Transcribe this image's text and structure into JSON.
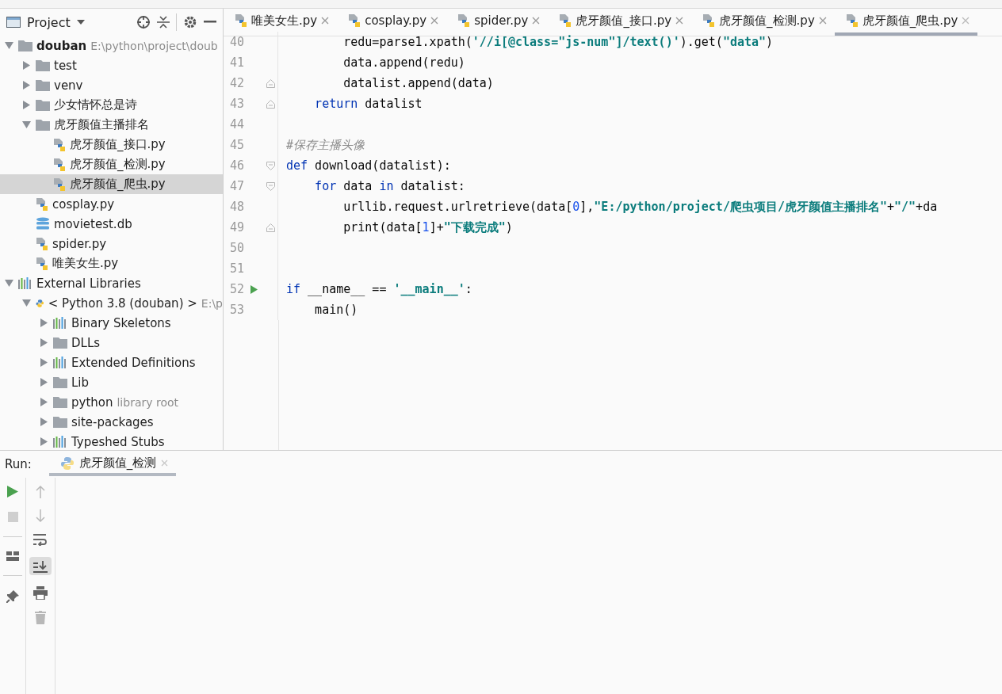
{
  "project_panel": {
    "title": "Project",
    "tree": [
      {
        "label": "douban",
        "hint": "E:\\python\\project\\doub",
        "kind": "folder",
        "bold": true,
        "expanded": true,
        "selected": false,
        "children": [
          {
            "label": "test",
            "kind": "folder",
            "expanded": false,
            "selected": false
          },
          {
            "label": "venv",
            "kind": "folder",
            "expanded": false,
            "selected": false
          },
          {
            "label": "少女情怀总是诗",
            "kind": "folder",
            "expanded": false,
            "selected": false
          },
          {
            "label": "虎牙颜值主播排名",
            "kind": "folder",
            "expanded": true,
            "selected": false,
            "children": [
              {
                "label": "虎牙颜值_接口.py",
                "kind": "python",
                "selected": false
              },
              {
                "label": "虎牙颜值_检测.py",
                "kind": "python",
                "selected": false
              },
              {
                "label": "虎牙颜值_爬虫.py",
                "kind": "python",
                "selected": true
              }
            ]
          },
          {
            "label": "cosplay.py",
            "kind": "python",
            "selected": false
          },
          {
            "label": "movietest.db",
            "kind": "database",
            "selected": false
          },
          {
            "label": "spider.py",
            "kind": "python",
            "selected": false
          },
          {
            "label": "唯美女生.py",
            "kind": "python",
            "selected": false
          }
        ]
      },
      {
        "label": "External Libraries",
        "kind": "library",
        "expanded": true,
        "selected": false,
        "children": [
          {
            "label": "< Python 3.8 (douban) >",
            "hint": "E:\\p",
            "kind": "interpreter",
            "expanded": true,
            "selected": false,
            "children": [
              {
                "label": "Binary Skeletons",
                "kind": "library",
                "expanded": false,
                "selected": false
              },
              {
                "label": "DLLs",
                "kind": "folder",
                "expanded": false,
                "selected": false
              },
              {
                "label": "Extended Definitions",
                "kind": "library",
                "expanded": false,
                "selected": false
              },
              {
                "label": "Lib",
                "kind": "folder",
                "expanded": false,
                "selected": false
              },
              {
                "label": "python",
                "hint": "library root",
                "kind": "folder",
                "expanded": false,
                "selected": false
              },
              {
                "label": "site-packages",
                "kind": "folder",
                "expanded": false,
                "selected": false
              },
              {
                "label": "Typeshed Stubs",
                "kind": "library",
                "expanded": false,
                "selected": false
              }
            ]
          }
        ]
      }
    ]
  },
  "editor_tabs": [
    {
      "label": "唯美女生.py",
      "selected": false
    },
    {
      "label": "cosplay.py",
      "selected": false
    },
    {
      "label": "spider.py",
      "selected": false
    },
    {
      "label": "虎牙颜值_接口.py",
      "selected": false
    },
    {
      "label": "虎牙颜值_检测.py",
      "selected": false
    },
    {
      "label": "虎牙颜值_爬虫.py",
      "selected": true
    }
  ],
  "code": [
    {
      "number": "40",
      "tokens": [
        {
          "kind": "plain",
          "text": "        redu=parse1.xpath("
        },
        {
          "kind": "string",
          "text": "'//i[@class=\"js-num\"]/text()'"
        },
        {
          "kind": "plain",
          "text": ").get("
        },
        {
          "kind": "string",
          "text": "\"data\""
        },
        {
          "kind": "plain",
          "text": ")"
        }
      ]
    },
    {
      "number": "41",
      "tokens": [
        {
          "kind": "plain",
          "text": "        data.append(redu)"
        }
      ]
    },
    {
      "number": "42",
      "fold_end": true,
      "tokens": [
        {
          "kind": "plain",
          "text": "        datalist.append(data)"
        }
      ]
    },
    {
      "number": "43",
      "fold_end": true,
      "tokens": [
        {
          "kind": "keyword",
          "text": "    return"
        },
        {
          "kind": "plain",
          "text": " datalist"
        }
      ]
    },
    {
      "number": "44"
    },
    {
      "number": "45",
      "tokens": [
        {
          "kind": "comment",
          "text": "#保存主播头像"
        }
      ]
    },
    {
      "number": "46",
      "fold_start": true,
      "tokens": [
        {
          "kind": "keyword",
          "text": "def"
        },
        {
          "kind": "plain",
          "text": " download(datalist):"
        }
      ]
    },
    {
      "number": "47",
      "fold_start": true,
      "tokens": [
        {
          "kind": "keyword",
          "text": "    for"
        },
        {
          "kind": "plain",
          "text": " data "
        },
        {
          "kind": "keyword",
          "text": "in"
        },
        {
          "kind": "plain",
          "text": " datalist:"
        }
      ]
    },
    {
      "number": "48",
      "tokens": [
        {
          "kind": "plain",
          "text": "        urllib.request.urlretrieve(data["
        },
        {
          "kind": "number",
          "text": "0"
        },
        {
          "kind": "plain",
          "text": "],"
        },
        {
          "kind": "string",
          "text": "\"E:/python/project/爬虫项目/虎牙颜值主播排名\""
        },
        {
          "kind": "plain",
          "text": "+"
        },
        {
          "kind": "string",
          "text": "\"/\""
        },
        {
          "kind": "plain",
          "text": "+da"
        }
      ]
    },
    {
      "number": "49",
      "fold_end": true,
      "tokens": [
        {
          "kind": "plain",
          "text": "        print(data["
        },
        {
          "kind": "number",
          "text": "1"
        },
        {
          "kind": "plain",
          "text": "]+"
        },
        {
          "kind": "string",
          "text": "\"下载完成\""
        },
        {
          "kind": "plain",
          "text": ")"
        }
      ]
    },
    {
      "number": "50"
    },
    {
      "number": "51"
    },
    {
      "number": "52",
      "run": true,
      "tokens": [
        {
          "kind": "keyword",
          "text": "if"
        },
        {
          "kind": "plain",
          "text": " __name__ == "
        },
        {
          "kind": "string",
          "text": "'__main__'"
        },
        {
          "kind": "plain",
          "text": ":"
        }
      ]
    },
    {
      "number": "53",
      "tokens": [
        {
          "kind": "plain",
          "text": "    main()"
        }
      ]
    }
  ],
  "run_panel": {
    "label": "Run:",
    "tab": "虎牙颜值_检测"
  }
}
